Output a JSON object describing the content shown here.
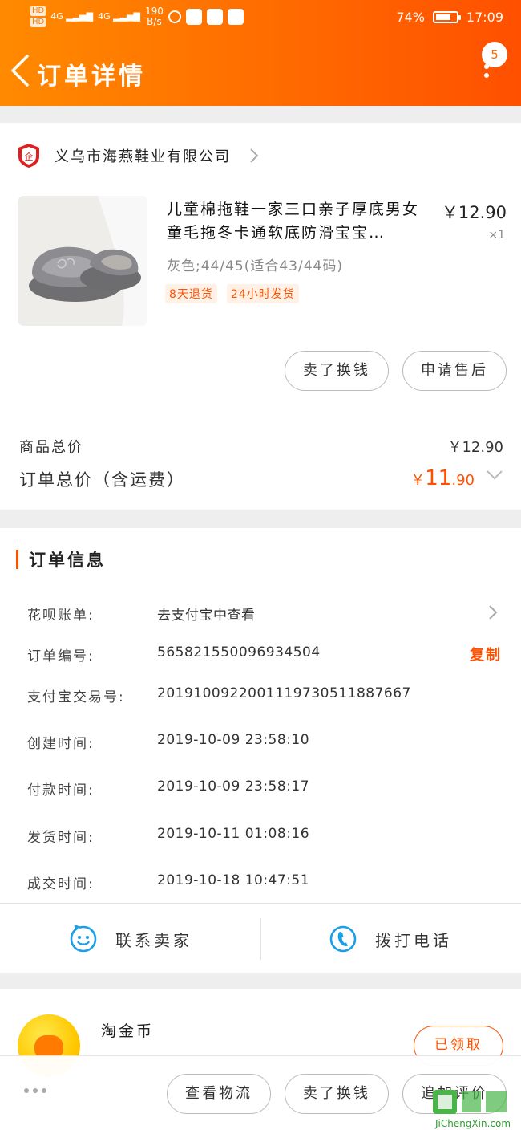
{
  "status_bar": {
    "hd1": "HD",
    "hd2": "HD",
    "net1": "4G",
    "net2": "4G",
    "speed_value": "190",
    "speed_unit": "B/s",
    "battery_percent": "74%",
    "battery_level": 0.74,
    "time": "17:09"
  },
  "nav": {
    "title": "订单详情",
    "badge": "5"
  },
  "shop": {
    "name": "义乌市海燕鞋业有限公司",
    "icon_text": "企"
  },
  "product": {
    "title": "儿童棉拖鞋一家三口亲子厚底男女童毛拖冬卡通软底防滑宝宝…",
    "price": "￥12.90",
    "quantity": "×1",
    "sku": "灰色;44/45(适合43/44码)",
    "tags": [
      "8天退货",
      "24小时发货"
    ]
  },
  "actions": {
    "sell": "卖了换钱",
    "after_sale": "申请售后"
  },
  "summary": {
    "goods_total_label": "商品总价",
    "goods_total_value": "￥12.90",
    "order_total_label": "订单总价（含运费）",
    "order_total_currency": "￥",
    "order_total_integer": "11",
    "order_total_decimal": ".90"
  },
  "order_info": {
    "title": "订单信息",
    "rows": [
      {
        "label": "花呗账单:",
        "value": "去支付宝中查看"
      },
      {
        "label": "订单编号:",
        "value": "565821550096934504"
      },
      {
        "label": "支付宝交易号:",
        "value": "2019100922001119730511887667"
      },
      {
        "label": "创建时间:",
        "value": "2019-10-09 23:58:10"
      },
      {
        "label": "付款时间:",
        "value": "2019-10-09 23:58:17"
      },
      {
        "label": "发货时间:",
        "value": "2019-10-11 01:08:16"
      },
      {
        "label": "成交时间:",
        "value": "2019-10-18 10:47:51"
      }
    ],
    "copy": "复制"
  },
  "contact": {
    "seller": "联系卖家",
    "call": "拨打电话"
  },
  "coin": {
    "title": "淘金币",
    "button": "已领取"
  },
  "bottom_bar": {
    "logistics": "查看物流",
    "sell": "卖了换钱",
    "review": "追加评价"
  },
  "watermark": {
    "text": "JiChengXin.com"
  },
  "colors": {
    "accent": "#ff5000",
    "header_start": "#ff8a00",
    "header_end": "#ff5000"
  }
}
